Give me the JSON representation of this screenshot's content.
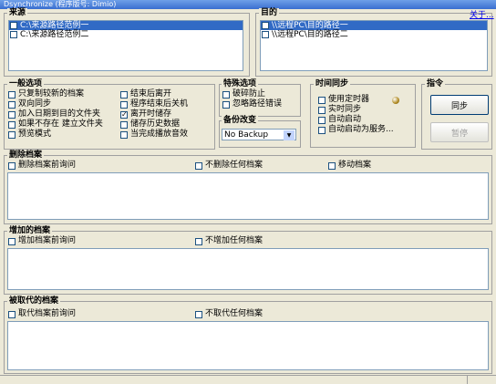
{
  "window": {
    "title": "Dsynchronize (程序版号: Dimio)"
  },
  "source": {
    "legend": "来源",
    "items": [
      {
        "label": "C:\\来源路径范例一",
        "checked": false,
        "selected": true
      },
      {
        "label": "C:\\来源路径范例二",
        "checked": false,
        "selected": false
      }
    ]
  },
  "dest": {
    "legend": "目的",
    "about_link": "关于...",
    "items": [
      {
        "label": "\\\\远程PC\\目的路径一",
        "checked": false,
        "selected": true
      },
      {
        "label": "\\\\远程PC\\目的路径二",
        "checked": false,
        "selected": false
      }
    ]
  },
  "general": {
    "legend": "一般选项",
    "options": [
      {
        "label": "只复制较新的档案",
        "checked": false
      },
      {
        "label": "双向同步",
        "checked": false
      },
      {
        "label": "加入日期到目的文件夹",
        "checked": false
      },
      {
        "label": "如果不存在 建立文件夹",
        "checked": false
      },
      {
        "label": "预览模式",
        "checked": false
      },
      {
        "label": "结束后离开",
        "checked": false
      },
      {
        "label": "程序结束后关机",
        "checked": false
      },
      {
        "label": "离开时储存",
        "checked": true
      },
      {
        "label": "储存历史数据",
        "checked": false
      },
      {
        "label": "当完成播放音效",
        "checked": false
      }
    ]
  },
  "special": {
    "legend": "特殊选项",
    "options": [
      {
        "label": "破碎防止",
        "checked": false
      },
      {
        "label": "忽略路径错误",
        "checked": false
      }
    ]
  },
  "backup": {
    "legend": "备份改变",
    "value": "No Backup"
  },
  "timesync": {
    "legend": "时间同步",
    "options": [
      {
        "label": "使用定时器",
        "checked": false
      },
      {
        "label": "实时同步",
        "checked": false
      },
      {
        "label": "自动启动",
        "checked": false
      },
      {
        "label": "自动启动为服务...",
        "checked": false
      }
    ]
  },
  "commands": {
    "legend": "指令",
    "sync_label": "同步",
    "pause_label": "暂停"
  },
  "deleted": {
    "legend": "删除档案",
    "options": [
      {
        "label": "删除档案前询问",
        "checked": false
      },
      {
        "label": "不删除任何档案",
        "checked": false
      },
      {
        "label": "移动档案",
        "checked": false
      }
    ]
  },
  "added": {
    "legend": "增加的档案",
    "options": [
      {
        "label": "增加档案前询问",
        "checked": false
      },
      {
        "label": "不增加任何档案",
        "checked": false
      }
    ]
  },
  "replaced": {
    "legend": "被取代的档案",
    "options": [
      {
        "label": "取代档案前询问",
        "checked": false
      },
      {
        "label": "不取代任何档案",
        "checked": false
      }
    ]
  }
}
